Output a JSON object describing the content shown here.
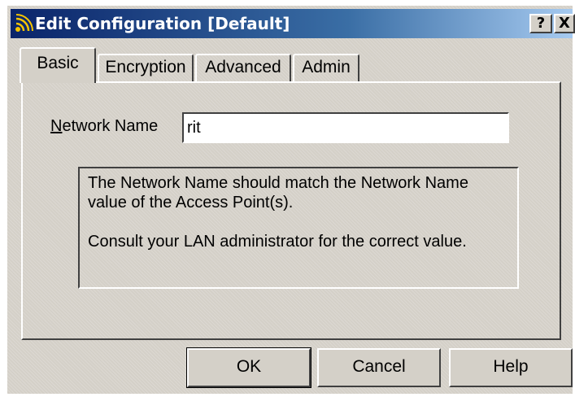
{
  "window": {
    "title": "Edit Configuration [Default]",
    "help_glyph": "?",
    "close_glyph": "X",
    "icon": "wireless-signal-icon",
    "colors": {
      "titlebar": "#0a246a",
      "face": "#d4d0c8"
    }
  },
  "tabs": [
    {
      "label": "Basic",
      "active": true
    },
    {
      "label": "Encryption",
      "active": false
    },
    {
      "label": "Advanced",
      "active": false
    },
    {
      "label": "Admin",
      "active": false
    }
  ],
  "basic": {
    "network_name_label_accel": "N",
    "network_name_label_rest": "etwork Name",
    "network_name_value": "rit",
    "info_line1": "The Network Name should match the Network Name value of the Access Point(s).",
    "info_line2": "Consult your LAN administrator for the correct value."
  },
  "buttons": {
    "ok": "OK",
    "cancel": "Cancel",
    "help": "Help"
  }
}
